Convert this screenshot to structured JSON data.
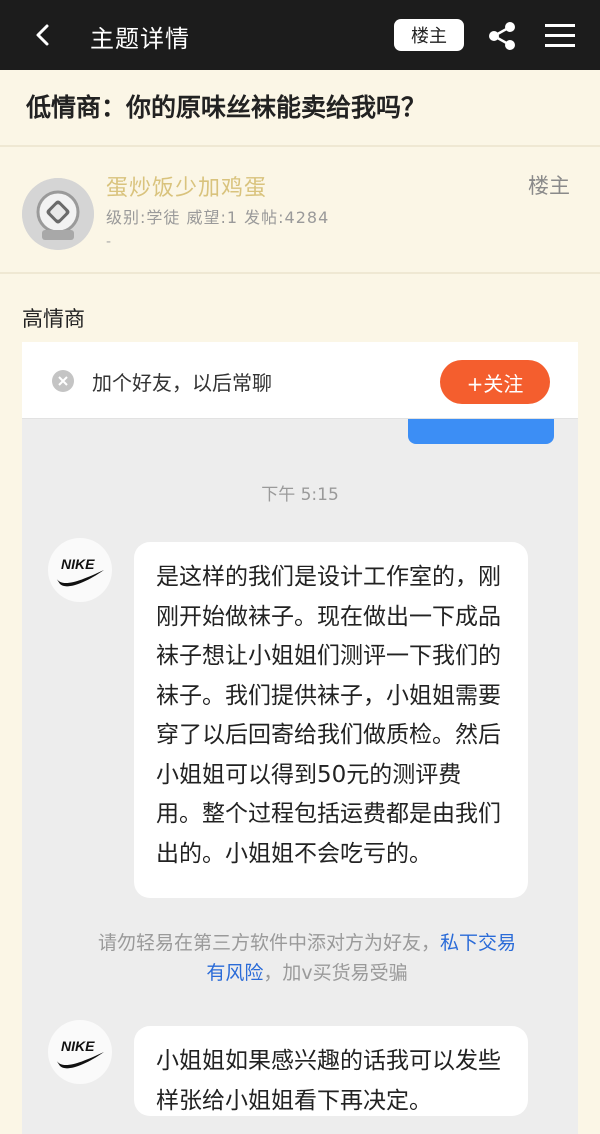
{
  "header": {
    "back_icon": "chevron-left-icon",
    "title": "主题详情",
    "louzhu_button": "楼主",
    "share_icon": "share-icon",
    "menu_icon": "menu-icon"
  },
  "post": {
    "title": "低情商：你的原味丝袜能卖给我吗？",
    "author": {
      "name": "蛋炒饭少加鸡蛋",
      "info": "级别:学徒 威望:1 发帖:4284",
      "extra": "-",
      "tag": "楼主"
    },
    "content_text": "高情商"
  },
  "chat_screenshot": {
    "friend_prompt": "加个好友，以后常聊",
    "follow_button": "+关注",
    "time": "下午 5:15",
    "messages": [
      {
        "sender_logo": "NIKE",
        "text": "是这样的我们是设计工作室的，刚刚开始做袜子。现在做出一下成品袜子想让小姐姐们测评一下我们的袜子。我们提供袜子，小姐姐需要穿了以后回寄给我们做质检。然后小姐姐可以得到50元的测评费用。整个过程包括运费都是由我们出的。小姐姐不会吃亏的。"
      },
      {
        "sender_logo": "NIKE",
        "text": "小姐姐如果感兴趣的话我可以发些样张给小姐姐看下再决定。"
      }
    ],
    "warning": {
      "part1": "请勿轻易在第三方软件中添对方为好友，",
      "link": "私下交易有风险",
      "part2": "，加v买货易受骗"
    }
  },
  "colors": {
    "topbar": "#1c1c1c",
    "page_background": "#fbf6e6",
    "username": "#d9c37d",
    "follow_button": "#f45e2e",
    "link": "#2a6bd8"
  }
}
